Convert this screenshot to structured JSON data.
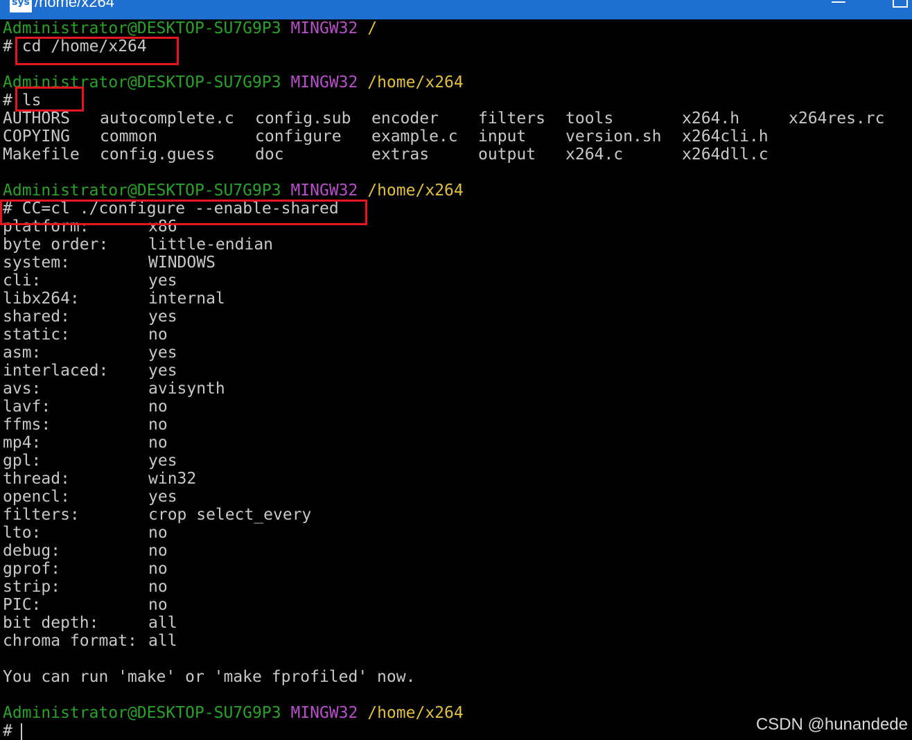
{
  "window": {
    "title": "/home/x264",
    "app_icon": "msys-icon",
    "icon_text": "sys"
  },
  "prompts": [
    {
      "user": "Administrator@DESKTOP-SU7G9P3",
      "env": "MINGW32",
      "path": "/",
      "command": "cd /home/x264"
    },
    {
      "user": "Administrator@DESKTOP-SU7G9P3",
      "env": "MINGW32",
      "path": "/home/x264",
      "command": "ls"
    },
    {
      "user": "Administrator@DESKTOP-SU7G9P3",
      "env": "MINGW32",
      "path": "/home/x264",
      "command": "CC=cl ./configure --enable-shared"
    },
    {
      "user": "Administrator@DESKTOP-SU7G9P3",
      "env": "MINGW32",
      "path": "/home/x264",
      "command": ""
    }
  ],
  "prompt_symbol": "#",
  "ls_output": [
    [
      "AUTHORS",
      "autocomplete.c",
      "config.sub",
      "encoder",
      "filters",
      "tools",
      "x264.h",
      "x264res.rc"
    ],
    [
      "COPYING",
      "common",
      "configure",
      "example.c",
      "input",
      "version.sh",
      "x264cli.h",
      ""
    ],
    [
      "Makefile",
      "config.guess",
      "doc",
      "extras",
      "output",
      "x264.c",
      "x264dll.c",
      ""
    ]
  ],
  "config_output": [
    {
      "key": "platform:",
      "value": "x86"
    },
    {
      "key": "byte order:",
      "value": "little-endian"
    },
    {
      "key": "system:",
      "value": "WINDOWS"
    },
    {
      "key": "cli:",
      "value": "yes"
    },
    {
      "key": "libx264:",
      "value": "internal"
    },
    {
      "key": "shared:",
      "value": "yes"
    },
    {
      "key": "static:",
      "value": "no"
    },
    {
      "key": "asm:",
      "value": "yes"
    },
    {
      "key": "interlaced:",
      "value": "yes"
    },
    {
      "key": "avs:",
      "value": "avisynth"
    },
    {
      "key": "lavf:",
      "value": "no"
    },
    {
      "key": "ffms:",
      "value": "no"
    },
    {
      "key": "mp4:",
      "value": "no"
    },
    {
      "key": "gpl:",
      "value": "yes"
    },
    {
      "key": "thread:",
      "value": "win32"
    },
    {
      "key": "opencl:",
      "value": "yes"
    },
    {
      "key": "filters:",
      "value": "crop select_every"
    },
    {
      "key": "lto:",
      "value": "no"
    },
    {
      "key": "debug:",
      "value": "no"
    },
    {
      "key": "gprof:",
      "value": "no"
    },
    {
      "key": "strip:",
      "value": "no"
    },
    {
      "key": "PIC:",
      "value": "no"
    },
    {
      "key": "bit depth:",
      "value": "all"
    },
    {
      "key": "chroma format:",
      "value": "all"
    }
  ],
  "final_message": "You can run 'make' or 'make fprofiled' now.",
  "watermark": "CSDN @hunandede",
  "colors": {
    "user": "#2aa12a",
    "env": "#b64fc8",
    "path": "#e0c040",
    "text": "#c8c8c8",
    "highlight": "#e8151c",
    "titlebar": "#1f6fd1"
  }
}
